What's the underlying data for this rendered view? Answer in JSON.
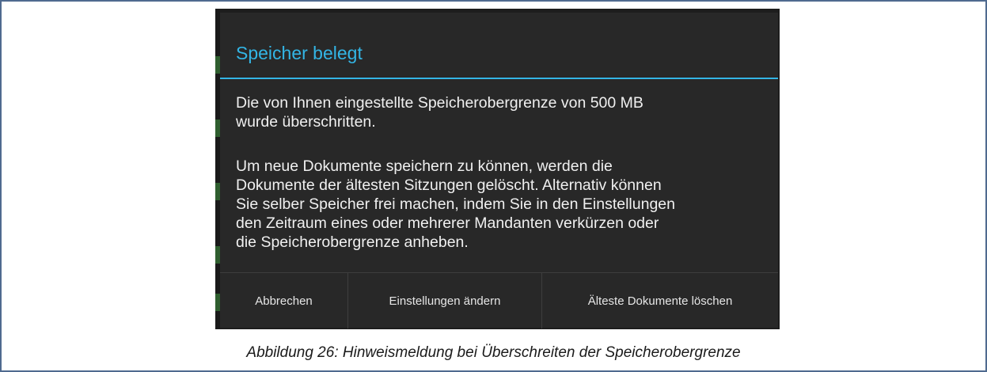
{
  "dialog": {
    "title": "Speicher belegt",
    "message_1": "Die von Ihnen  eingestellte Speicherobergrenze von 500 MB\nwurde überschritten.",
    "message_2": "Um neue Dokumente speichern zu können, werden die\nDokumente der ältesten Sitzungen gelöscht. Alternativ können\nSie selber Speicher frei machen, indem Sie in den Einstellungen\nden Zeitraum eines oder mehrerer Mandanten verkürzen oder\ndie Speicherobergrenze anheben.",
    "buttons": {
      "cancel": "Abbrechen",
      "change_settings": "Einstellungen ändern",
      "delete_oldest": "Älteste Dokumente löschen"
    }
  },
  "caption": "Abbildung 26: Hinweismeldung bei Überschreiten der Speicherobergrenze",
  "colors": {
    "accent": "#33b5e5",
    "dialog_background": "#282828",
    "frame_border": "#4f6a8f"
  }
}
